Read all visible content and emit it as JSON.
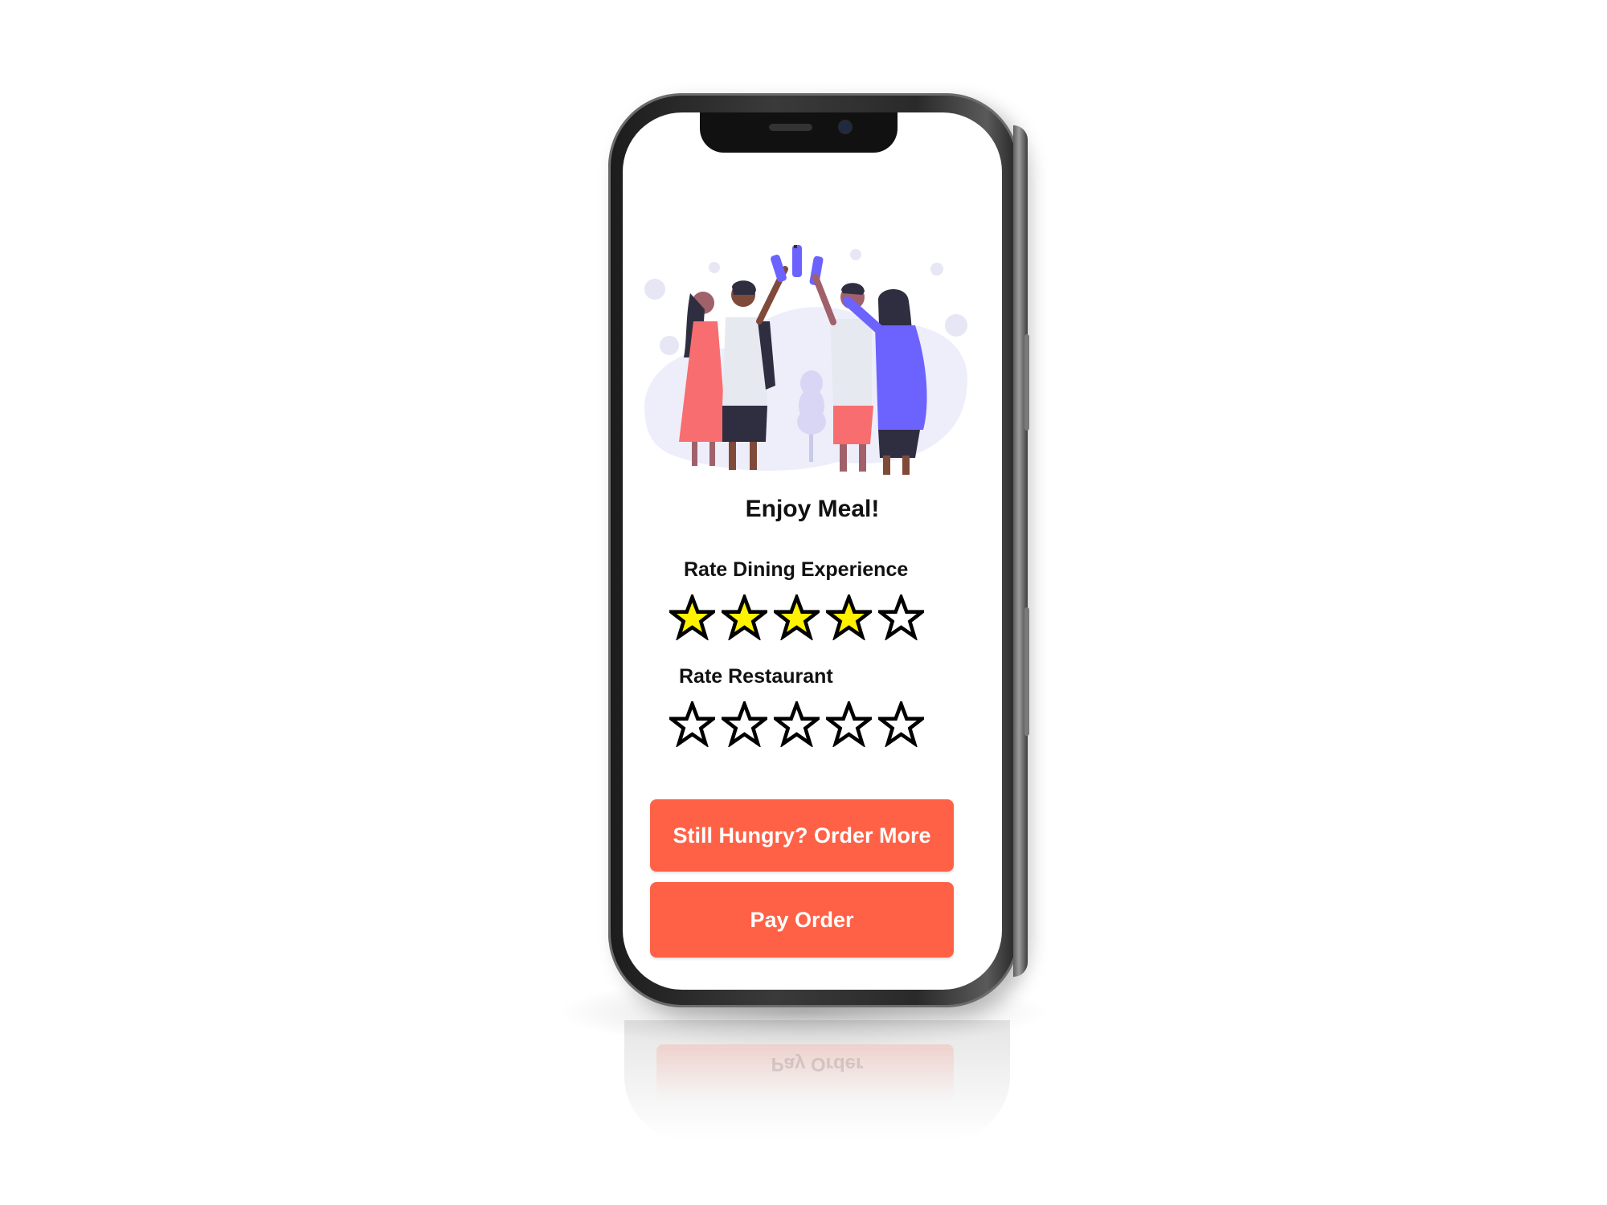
{
  "screen": {
    "title": "Enjoy Meal!",
    "dining_rating": {
      "label": "Rate Dining Experience",
      "value": 4,
      "max": 5
    },
    "restaurant_rating": {
      "label": "Rate Restaurant",
      "value": 0,
      "max": 5
    },
    "buttons": {
      "order_more_label": "Still Hungry? Order More",
      "pay_label": "Pay Order"
    },
    "illustration_icon": "friends-toasting-illustration"
  },
  "colors": {
    "accent": "#ff6146",
    "star_filled": "#fff200",
    "star_outline": "#000000",
    "illustration_primary": "#6c63ff",
    "illustration_blob": "#eeeefb"
  }
}
